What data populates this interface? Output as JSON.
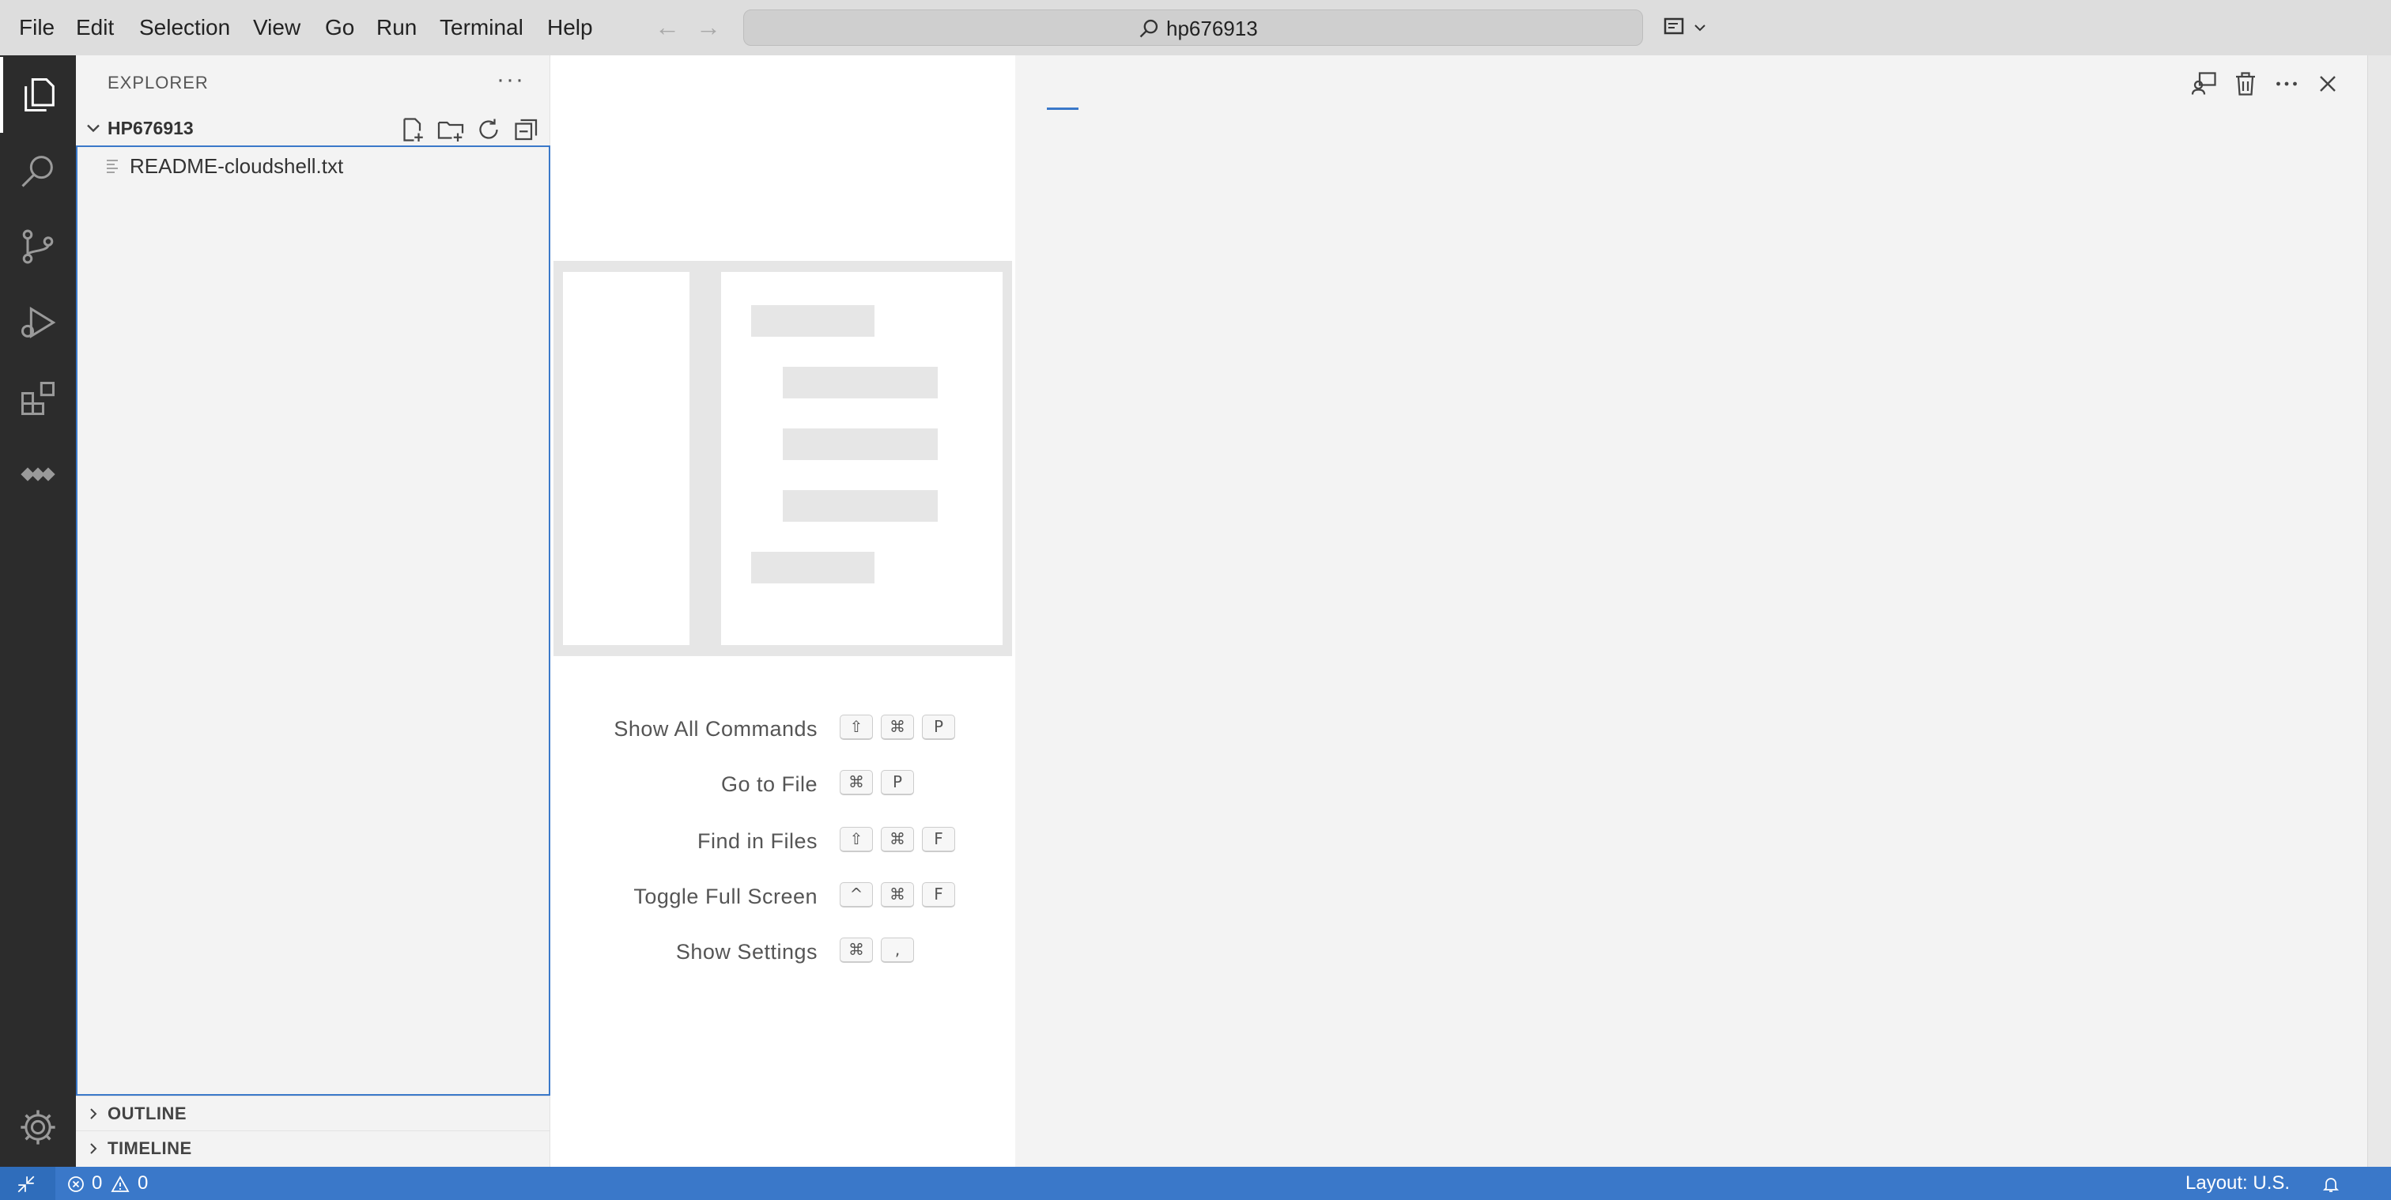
{
  "menu": {
    "items": [
      "File",
      "Edit",
      "Selection",
      "View",
      "Go",
      "Run",
      "Terminal",
      "Help"
    ]
  },
  "command_center": {
    "text": "hp676913",
    "icon": "search-icon"
  },
  "activity_bar": {
    "items": [
      "explorer-icon",
      "search-icon",
      "source-control-icon",
      "run-debug-icon",
      "extensions-icon",
      "remote-icon"
    ],
    "bottom": "settings-gear-icon"
  },
  "sidebar": {
    "title": "EXPLORER",
    "more": "···",
    "folder": {
      "name": "HP676913"
    },
    "files": [
      {
        "name": "README-cloudshell.txt"
      }
    ],
    "panels": [
      "OUTLINE",
      "TIMELINE"
    ]
  },
  "welcome": {
    "shortcuts": [
      {
        "label": "Show All Commands",
        "keys": [
          "⇧",
          "⌘",
          "P"
        ]
      },
      {
        "label": "Go to File",
        "keys": [
          "⌘",
          "P"
        ]
      },
      {
        "label": "Find in Files",
        "keys": [
          "⇧",
          "⌘",
          "F"
        ]
      },
      {
        "label": "Toggle Full Screen",
        "keys": [
          "^",
          "⌘",
          "F"
        ]
      },
      {
        "label": "Show Settings",
        "keys": [
          "⌘",
          ","
        ]
      }
    ]
  },
  "statusbar": {
    "errors": "0",
    "warnings": "0",
    "layout": "Layout: U.S."
  },
  "colors": {
    "accent": "#3a78c9",
    "activity_bar": "#2c2c2c",
    "titlebar": "#dddddd"
  }
}
